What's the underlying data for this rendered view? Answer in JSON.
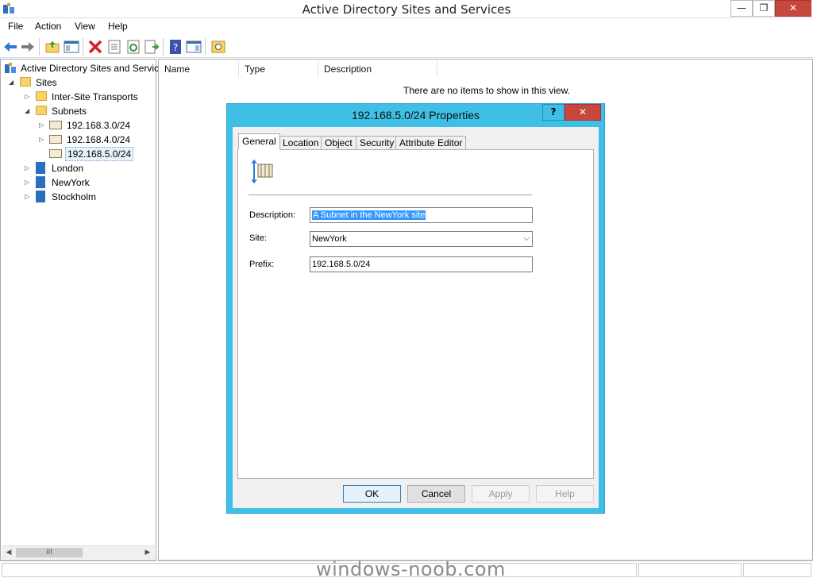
{
  "window": {
    "title": "Active Directory Sites and Services",
    "min_glyph": "—",
    "max_glyph": "❐",
    "close_glyph": "✕"
  },
  "menu": [
    "File",
    "Action",
    "View",
    "Help"
  ],
  "toolbar_icons": [
    "back-arrow-icon",
    "forward-arrow-icon",
    "up-folder-icon",
    "show-console-tree-icon",
    "delete-icon",
    "properties-icon",
    "refresh-icon",
    "export-list-icon",
    "help-icon",
    "show-action-pane-icon",
    "service-icon"
  ],
  "tree": {
    "root": "Active Directory Sites and Servic",
    "sites": "Sites",
    "inter_site": "Inter-Site Transports",
    "subnets": "Subnets",
    "subnet_items": [
      "192.168.3.0/24",
      "192.168.4.0/24",
      "192.168.5.0/24"
    ],
    "site_items": [
      "London",
      "NewYork",
      "Stockholm"
    ],
    "scroll_thumb_glyph": "III"
  },
  "list": {
    "columns": [
      "Name",
      "Type",
      "Description"
    ],
    "empty_message": "There are no items to show in this view."
  },
  "dialog": {
    "title": "192.168.5.0/24 Properties",
    "help_glyph": "?",
    "close_glyph": "✕",
    "tabs": [
      "General",
      "Location",
      "Object",
      "Security",
      "Attribute Editor"
    ],
    "active_tab": "General",
    "description_label": "Description:",
    "description_value": "A Subnet in the NewYork site",
    "site_label": "Site:",
    "site_value": "NewYork",
    "prefix_label": "Prefix:",
    "prefix_value": "192.168.5.0/24",
    "buttons": {
      "ok": "OK",
      "cancel": "Cancel",
      "apply": "Apply",
      "help": "Help"
    }
  },
  "watermark": "windows-noob.com",
  "colors": {
    "dialog_frame": "#3fbfe6",
    "close_button": "#c7463e",
    "selection": "#3399ff"
  }
}
